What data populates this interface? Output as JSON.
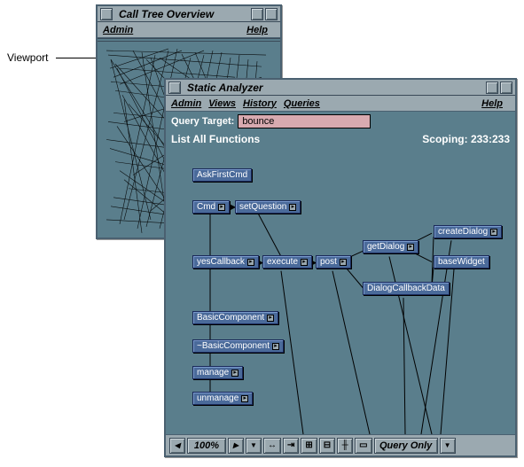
{
  "viewport_label": "Viewport",
  "window1": {
    "title": "Call Tree Overview",
    "menu": {
      "admin": "Admin",
      "help": "Help"
    }
  },
  "window2": {
    "title": "Static Analyzer",
    "menu": {
      "admin": "Admin",
      "views": "Views",
      "history": "History",
      "queries": "Queries",
      "help": "Help"
    },
    "query_label": "Query Target:",
    "query_value": "bounce",
    "list_label": "List All Functions",
    "scoping_label": "Scoping: 233:233",
    "nodes": {
      "askFirstCmd": "AskFirstCmd",
      "cmd": "Cmd",
      "setQuestion": "setQuestion",
      "yesCallback": "yesCallback",
      "execute": "execute",
      "post": "post",
      "getDialog": "getDialog",
      "createDialog": "createDialog",
      "baseWidget": "baseWidget",
      "dialogCallbackData": "DialogCallbackData",
      "basicComponent": "BasicComponent",
      "tbasicComponent": "~BasicComponent",
      "manage": "manage",
      "unmanage": "unmanage"
    },
    "toolbar": {
      "zoom": "100%",
      "query_only": "Query Only"
    }
  }
}
